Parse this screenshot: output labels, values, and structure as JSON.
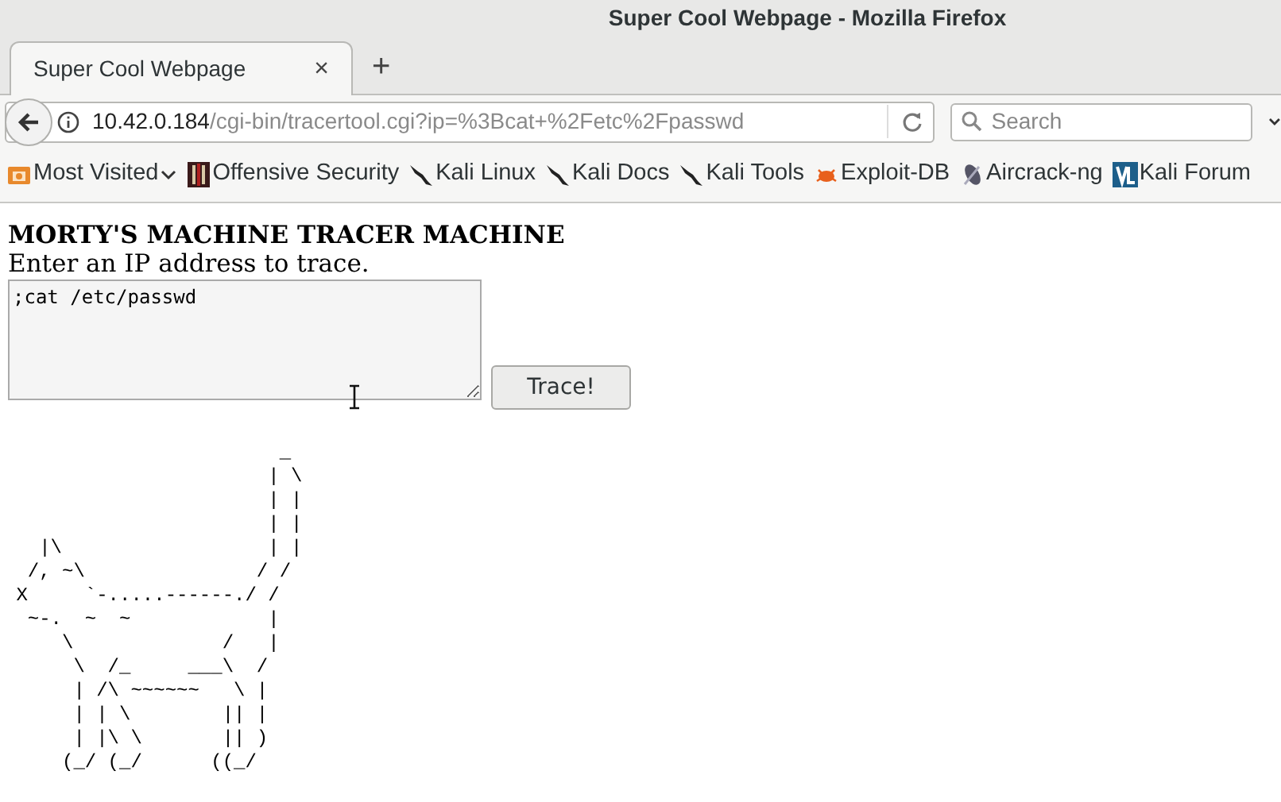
{
  "window": {
    "title": "Super Cool Webpage - Mozilla Firefox"
  },
  "tabs": [
    {
      "label": "Super Cool Webpage",
      "selected": true,
      "close": "×"
    }
  ],
  "new_tab": "+",
  "address_bar": {
    "host": "10.42.0.184",
    "path": "/cgi-bin/tracertool.cgi?ip=%3Bcat+%2Fetc%2Fpasswd"
  },
  "search": {
    "placeholder": "Search"
  },
  "bookmarks": [
    {
      "label": "Most Visited",
      "kind": "folder"
    },
    {
      "label": "Offensive Security",
      "kind": "offsec"
    },
    {
      "label": "Kali Linux",
      "kind": "kali"
    },
    {
      "label": "Kali Docs",
      "kind": "kali"
    },
    {
      "label": "Kali Tools",
      "kind": "kali"
    },
    {
      "label": "Exploit-DB",
      "kind": "exploitdb"
    },
    {
      "label": "Aircrack-ng",
      "kind": "aircrack"
    },
    {
      "label": "Kali Forum",
      "kind": "forum"
    }
  ],
  "page": {
    "heading": "MORTY'S MACHINE TRACER MACHINE",
    "prompt": "Enter an IP address to trace.",
    "input_value": ";cat /etc/passwd",
    "button": "Trace!",
    "output": [
      "                        _",
      "                       | \\",
      "                       | |",
      "                       | |",
      "   |\\                  | |",
      "  /, ~\\               / /",
      " X     `-.....------./ /",
      "  ~-.  ~  ~            |",
      "     \\             /   |",
      "      \\  /_     ___\\  /",
      "      | /\\ ~~~~~~   \\ |",
      "      | | \\        || |",
      "      | |\\ \\       || )",
      "     (_/ (_/      ((_/"
    ]
  }
}
